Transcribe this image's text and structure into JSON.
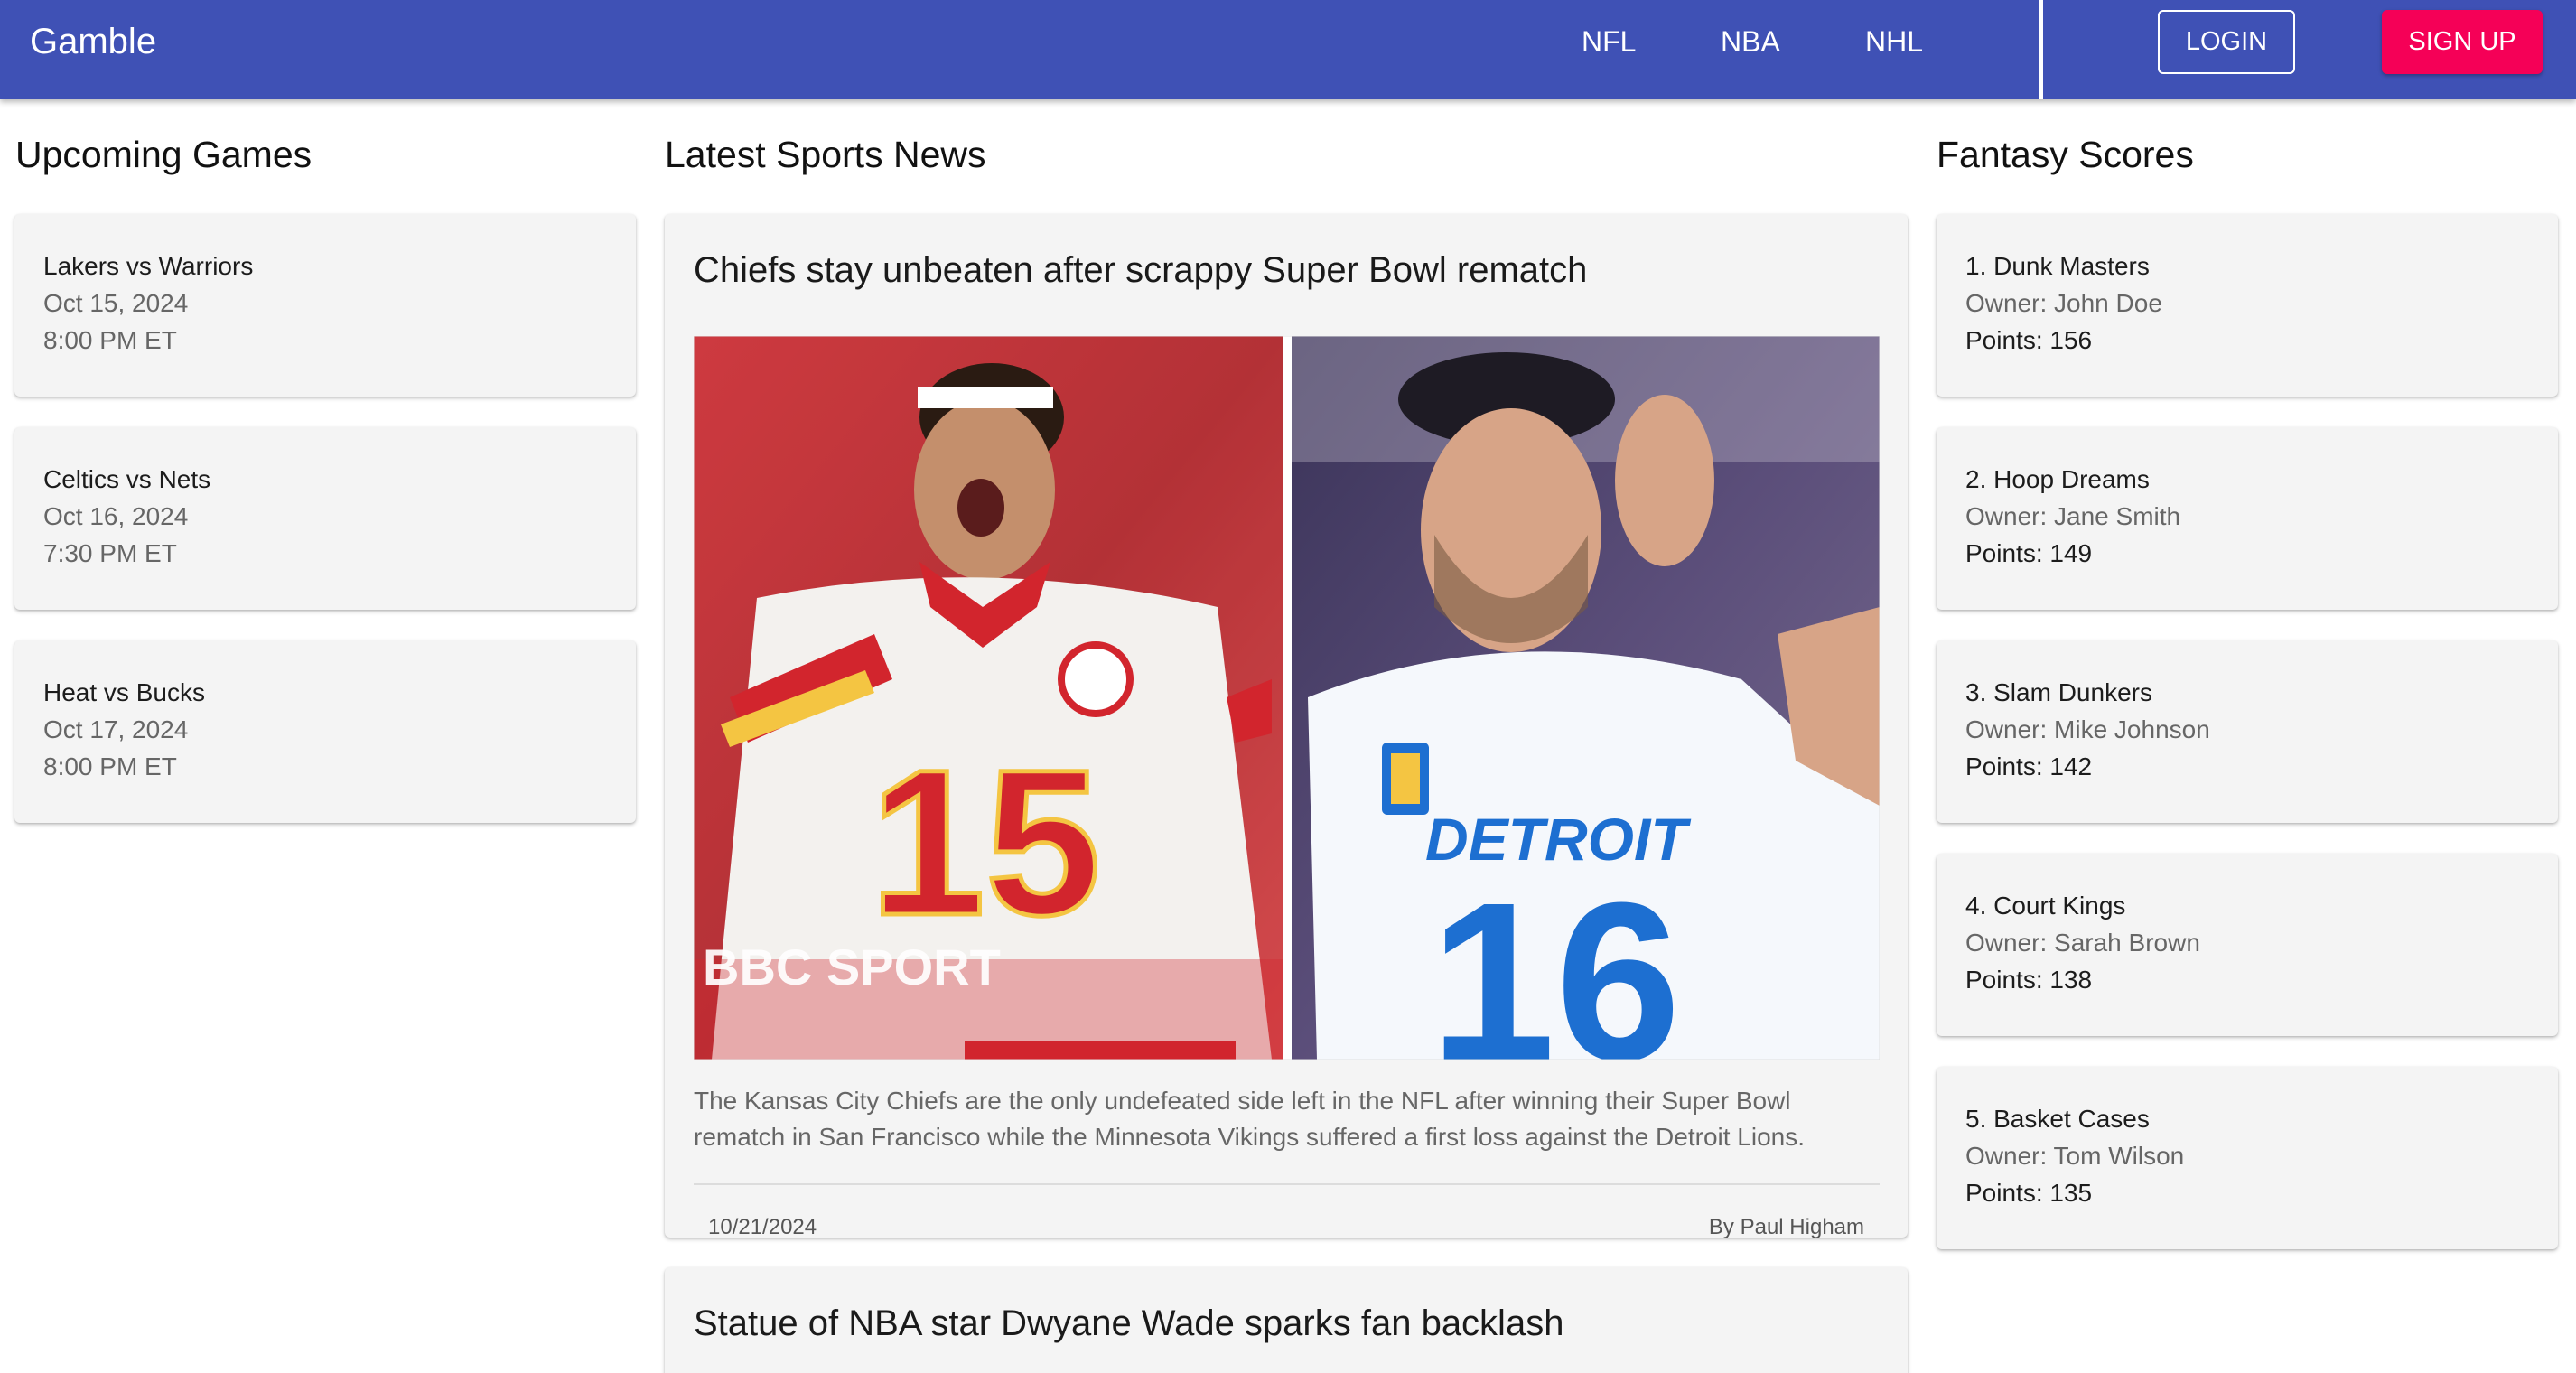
{
  "app": {
    "brand": "Gamble"
  },
  "nav": {
    "links": [
      "NFL",
      "NBA",
      "NHL"
    ],
    "login": "LOGIN",
    "signup": "SIGN UP"
  },
  "colors": {
    "appbar": "#3f51b5",
    "signup": "#f50057",
    "card": "#f4f4f4"
  },
  "upcoming": {
    "title": "Upcoming Games",
    "games": [
      {
        "matchup": "Lakers vs Warriors",
        "date": "Oct 15, 2024",
        "time": "8:00 PM ET"
      },
      {
        "matchup": "Celtics vs Nets",
        "date": "Oct 16, 2024",
        "time": "7:30 PM ET"
      },
      {
        "matchup": "Heat vs Bucks",
        "date": "Oct 17, 2024",
        "time": "8:00 PM ET"
      }
    ]
  },
  "news": {
    "title": "Latest Sports News",
    "articles": [
      {
        "headline": "Chiefs stay unbeaten after scrappy Super Bowl rematch",
        "image": {
          "left_number": "15",
          "right_number": "16",
          "right_wordmark": "DETROIT",
          "watermark": "BBC SPORT"
        },
        "summary": "The Kansas City Chiefs are the only undefeated side left in the NFL after winning their Super Bowl rematch in San Francisco while the Minnesota Vikings suffered a first loss against the Detroit Lions.",
        "date": "10/21/2024",
        "author": "By Paul Higham"
      },
      {
        "headline": "Statue of NBA star Dwyane Wade sparks fan backlash"
      }
    ]
  },
  "fantasy": {
    "title": "Fantasy Scores",
    "teams": [
      {
        "name": "1. Dunk Masters",
        "owner": "Owner: John Doe",
        "points": "Points: 156"
      },
      {
        "name": "2. Hoop Dreams",
        "owner": "Owner: Jane Smith",
        "points": "Points: 149"
      },
      {
        "name": "3. Slam Dunkers",
        "owner": "Owner: Mike Johnson",
        "points": "Points: 142"
      },
      {
        "name": "4. Court Kings",
        "owner": "Owner: Sarah Brown",
        "points": "Points: 138"
      },
      {
        "name": "5. Basket Cases",
        "owner": "Owner: Tom Wilson",
        "points": "Points: 135"
      }
    ]
  }
}
